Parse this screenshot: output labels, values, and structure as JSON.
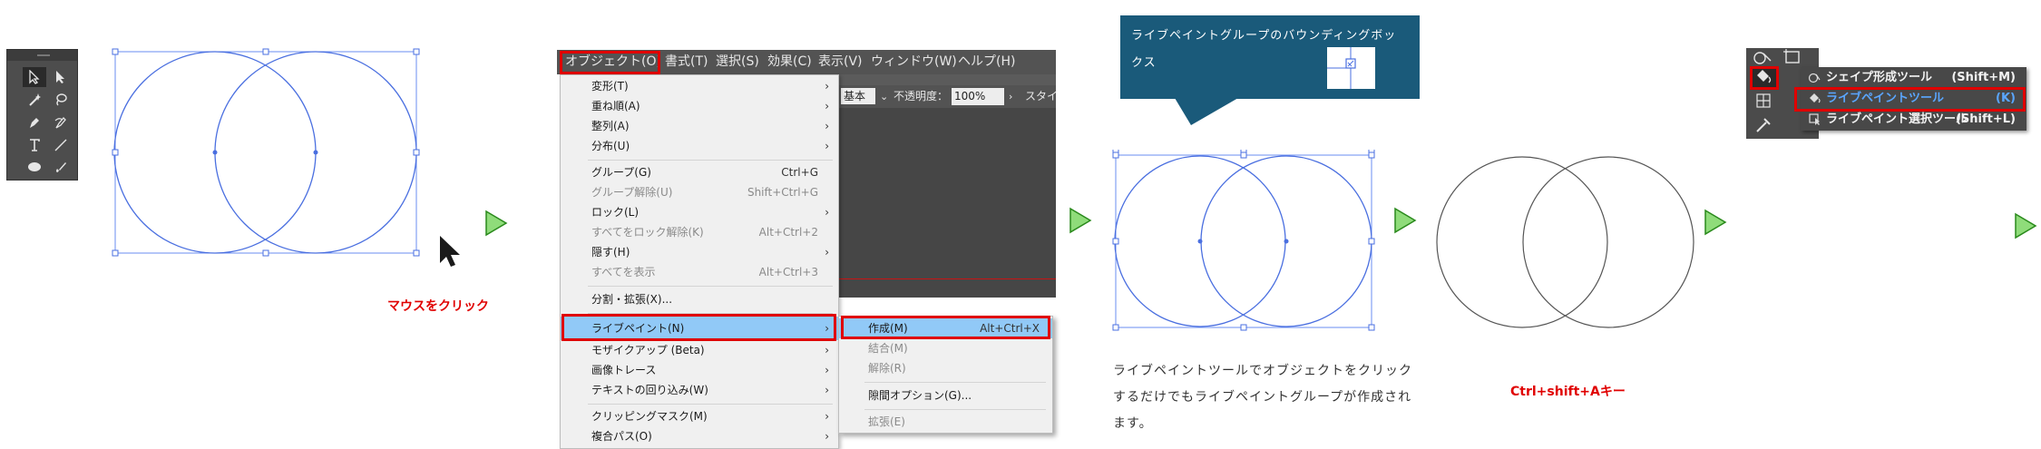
{
  "panel1": {
    "caption": "マウスをクリック",
    "tools_icons": [
      "selection-tool-icon",
      "direct-selection-tool-icon",
      "magic-wand-tool-icon",
      "lasso-tool-icon",
      "pen-tool-icon",
      "curvature-tool-icon",
      "type-tool-icon",
      "line-segment-tool-icon",
      "ellipse-tool-icon",
      "paintbrush-tool-icon"
    ]
  },
  "panel2": {
    "menubar": [
      "オブジェクト(O)",
      "書式(T)",
      "選択(S)",
      "効果(C)",
      "表示(V)",
      "ウィンドウ(W)",
      "ヘルプ(H)"
    ],
    "ctrlbar": {
      "basic": "基本",
      "opacity_label": "不透明度：",
      "opacity_value": "100%",
      "style_label": "スタイ"
    },
    "menu_items": [
      {
        "label": "変形(T)",
        "shortcut": "",
        "arrow": "›",
        "disabled": false
      },
      {
        "label": "重ね順(A)",
        "shortcut": "",
        "arrow": "›",
        "disabled": false
      },
      {
        "label": "整列(A)",
        "shortcut": "",
        "arrow": "›",
        "disabled": false
      },
      {
        "label": "分布(U)",
        "shortcut": "",
        "arrow": "›",
        "disabled": false
      },
      {
        "label": "グループ(G)",
        "shortcut": "Ctrl+G",
        "arrow": "",
        "disabled": false
      },
      {
        "label": "グループ解除(U)",
        "shortcut": "Shift+Ctrl+G",
        "arrow": "",
        "disabled": true
      },
      {
        "label": "ロック(L)",
        "shortcut": "",
        "arrow": "›",
        "disabled": false
      },
      {
        "label": "すべてをロック解除(K)",
        "shortcut": "Alt+Ctrl+2",
        "arrow": "",
        "disabled": true
      },
      {
        "label": "隠す(H)",
        "shortcut": "",
        "arrow": "›",
        "disabled": false
      },
      {
        "label": "すべてを表示",
        "shortcut": "Alt+Ctrl+3",
        "arrow": "",
        "disabled": true
      },
      {
        "label": "分割・拡張(X)...",
        "shortcut": "",
        "arrow": "",
        "disabled": false
      },
      {
        "label": "ライブペイント(N)",
        "shortcut": "",
        "arrow": "›",
        "disabled": false
      },
      {
        "label": "モザイクアップ (Beta)",
        "shortcut": "",
        "arrow": "›",
        "disabled": false
      },
      {
        "label": "画像トレース",
        "shortcut": "",
        "arrow": "›",
        "disabled": false
      },
      {
        "label": "テキストの回り込み(W)",
        "shortcut": "",
        "arrow": "›",
        "disabled": false
      },
      {
        "label": "クリッピングマスク(M)",
        "shortcut": "",
        "arrow": "›",
        "disabled": false
      },
      {
        "label": "複合パス(O)",
        "shortcut": "",
        "arrow": "›",
        "disabled": false
      }
    ],
    "submenu_items": [
      {
        "label": "作成(M)",
        "shortcut": "Alt+Ctrl+X",
        "disabled": false
      },
      {
        "label": "結合(M)",
        "shortcut": "",
        "disabled": true
      },
      {
        "label": "解除(R)",
        "shortcut": "",
        "disabled": true
      },
      {
        "label": "隙間オプション(G)...",
        "shortcut": "",
        "disabled": false
      },
      {
        "label": "拡張(E)",
        "shortcut": "",
        "disabled": true
      }
    ]
  },
  "panel3": {
    "callout_text": "ライブペイントグループのバウンディングボックス",
    "description": "ライブペイントツールでオブジェクトをクリックするだけでもライブペイントグループが作成されます。"
  },
  "panel4": {
    "caption": "Ctrl+shift+Aキー"
  },
  "panel5": {
    "flyout": [
      {
        "label": "シェイプ形成ツール",
        "shortcut": "(Shift+M)",
        "active": false
      },
      {
        "label": "ライブペイントツール",
        "shortcut": "(K)",
        "active": true
      },
      {
        "label": "ライブペイント選択ツール",
        "shortcut": "(Shift+L)",
        "active": false
      }
    ]
  },
  "colors": {
    "accent_blue": "#4a6fe0",
    "highlight_red": "#e00000",
    "arrow_green": "#8fdc7a",
    "callout_bg": "#1a5a7a"
  }
}
